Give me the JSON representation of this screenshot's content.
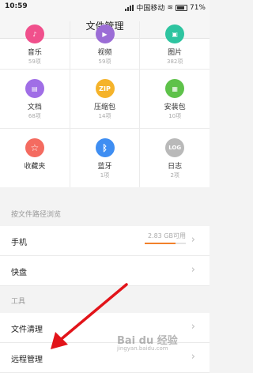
{
  "status": {
    "time": "10:59",
    "carrier": "中国移动",
    "battery": "71%"
  },
  "title": "文件管理",
  "categories": [
    {
      "label": "音乐",
      "count": "59项",
      "color": "#f0508c",
      "icon": "music-icon",
      "glyph": "♪"
    },
    {
      "label": "视频",
      "count": "59项",
      "color": "#9b6dd6",
      "icon": "video-icon",
      "glyph": "▶"
    },
    {
      "label": "图片",
      "count": "382项",
      "color": "#2ec4a0",
      "icon": "image-icon",
      "glyph": "▣"
    },
    {
      "label": "文档",
      "count": "68项",
      "color": "#a06ee6",
      "icon": "document-icon",
      "glyph": "▤"
    },
    {
      "label": "压缩包",
      "count": "14项",
      "color": "#f5b32a",
      "icon": "zip-icon",
      "glyph": "ZIP"
    },
    {
      "label": "安装包",
      "count": "10项",
      "color": "#5ec24a",
      "icon": "apk-icon",
      "glyph": "▦"
    },
    {
      "label": "收藏夹",
      "count": "",
      "color": "#f46b60",
      "icon": "star-icon",
      "glyph": "☆"
    },
    {
      "label": "蓝牙",
      "count": "1项",
      "color": "#3f8ef2",
      "icon": "bluetooth-icon",
      "glyph": "ᛒ"
    },
    {
      "label": "日志",
      "count": "2项",
      "color": "#b9b9b9",
      "icon": "log-icon",
      "glyph": "LOG"
    }
  ],
  "path_section": {
    "header": "按文件路径浏览",
    "phone": {
      "label": "手机",
      "storage": "2.83 GB可用",
      "used_fraction": 0.75
    },
    "disk": {
      "label": "快盘"
    }
  },
  "tools_section": {
    "header": "工具",
    "cleanup": {
      "label": "文件清理"
    },
    "remote": {
      "label": "远程管理"
    }
  },
  "watermark": {
    "text": "Bai du 经验",
    "sub": "jingyan.baidu.com"
  }
}
